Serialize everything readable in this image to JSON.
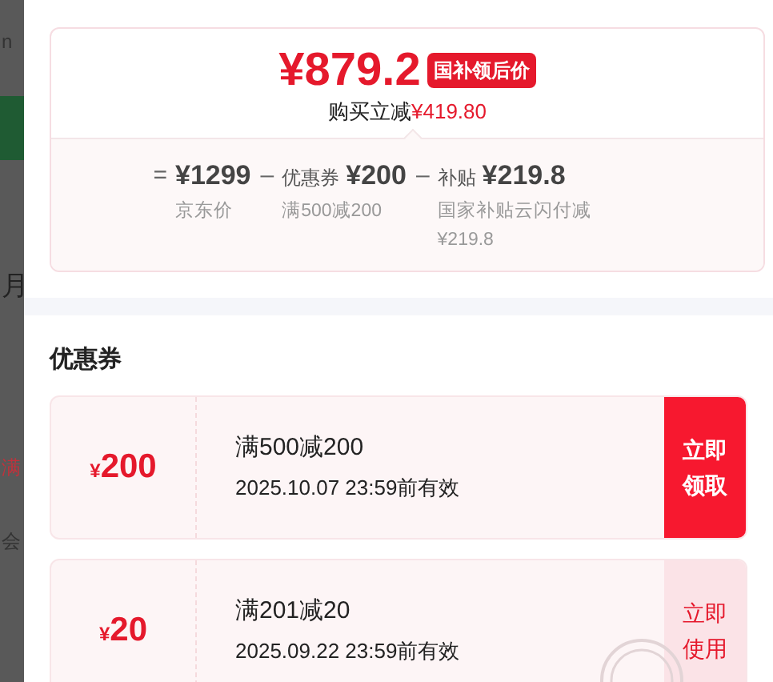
{
  "background_page": {
    "fragments": [
      "n",
      "月",
      "满",
      "会"
    ]
  },
  "price_summary": {
    "final_price": "¥879.2",
    "badge": "国补领后价",
    "saving_label": "购买立减",
    "saving_amount": "¥419.80",
    "breakdown": [
      {
        "operator": "=",
        "amount": "¥1299",
        "note": "京东价"
      },
      {
        "operator": "–",
        "name": "优惠券",
        "amount": "¥200",
        "note": "满500减200"
      },
      {
        "operator": "–",
        "name": "补贴",
        "amount": "¥219.8",
        "note": "国家补贴云闪付减¥219.8"
      }
    ]
  },
  "coupons_section": {
    "title": "优惠券",
    "coupons": [
      {
        "currency": "¥",
        "value": "200",
        "condition": "满500减200",
        "validity": "2025.10.07 23:59前有效",
        "action": "立即领取",
        "claimed": false
      },
      {
        "currency": "¥",
        "value": "20",
        "condition": "满201减20",
        "validity": "2025.09.22 23:59前有效",
        "action": "立即使用",
        "claimed": true
      }
    ]
  }
}
